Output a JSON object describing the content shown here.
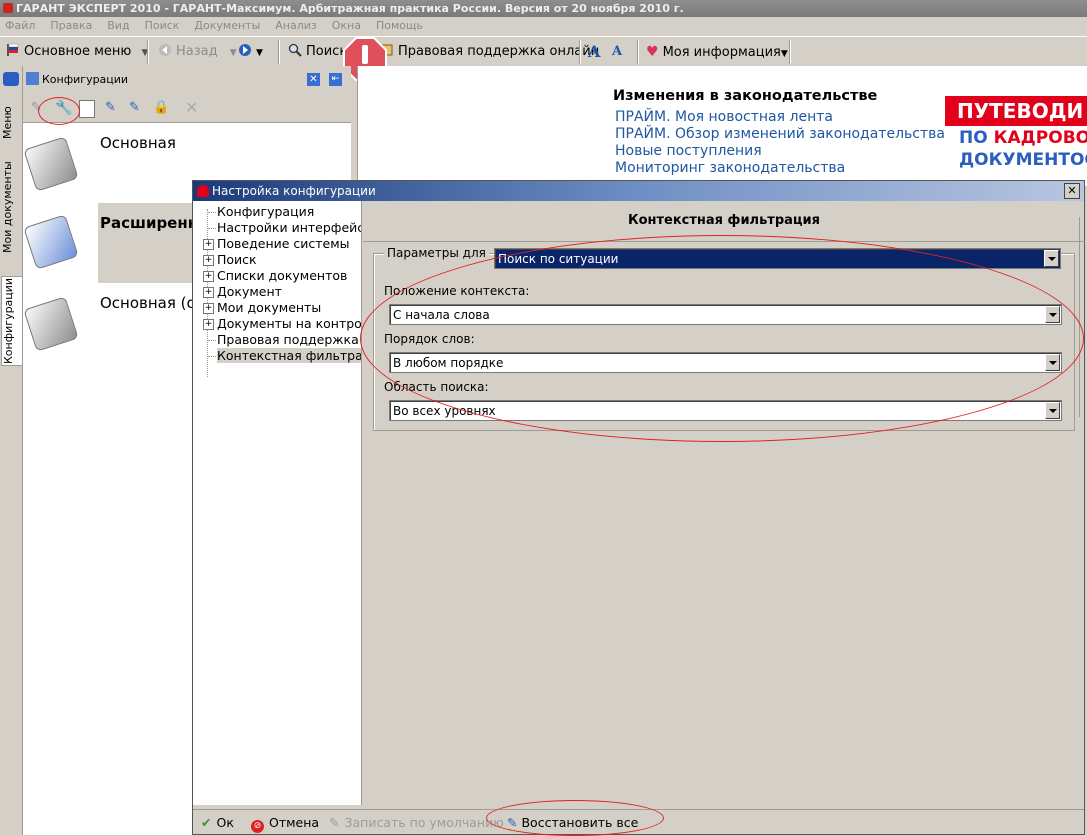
{
  "window": {
    "title": "ГАРАНТ ЭКСПЕРТ 2010 - ГАРАНТ-Максимум. Арбитражная практика России. Версия от 20 ноября 2010 г."
  },
  "menubar": [
    "Файл",
    "Правка",
    "Вид",
    "Поиск",
    "Документы",
    "Анализ",
    "Окна",
    "Помощь"
  ],
  "toolbar": {
    "main_menu": "Основное меню",
    "back": "Назад",
    "search": "Поиск",
    "support": "Правовая поддержка онлайн",
    "my_info": "Моя информация"
  },
  "vtabs": {
    "menu": "Меню",
    "my_docs": "Мои документы",
    "configs": "Конфигурации"
  },
  "config_panel": {
    "title": "Конфигурации",
    "items": [
      "Основная",
      "Расширенн",
      "Основная (с"
    ]
  },
  "content": {
    "heading": "Изменения в законодательстве",
    "links": [
      "ПРАЙМ. Моя новостная лента",
      "ПРАЙМ. Обзор изменений законодательства",
      "Новые поступления",
      "Мониторинг законодательства"
    ],
    "banner_line1": "ПУТЕВОДИ",
    "banner_line2a": "ПО ",
    "banner_line2b": "КАДРОВО",
    "banner_line3": "ДОКУМЕНТОС"
  },
  "dialog": {
    "title": "Настройка конфигурации",
    "tree": [
      {
        "label": "Конфигурация",
        "expandable": false
      },
      {
        "label": "Настройки интерфейса",
        "expandable": false
      },
      {
        "label": "Поведение системы",
        "expandable": true
      },
      {
        "label": "Поиск",
        "expandable": true
      },
      {
        "label": "Списки документов",
        "expandable": true
      },
      {
        "label": "Документ",
        "expandable": true
      },
      {
        "label": "Мои документы",
        "expandable": true
      },
      {
        "label": "Документы на контроле",
        "expandable": true
      },
      {
        "label": "Правовая поддержка он",
        "expandable": false
      },
      {
        "label": "Контекстная фильтрация",
        "expandable": false
      }
    ],
    "panel_title": "Контекстная фильтрация",
    "params_label": "Параметры для",
    "params_value": "Поиск по ситуации",
    "context_pos_label": "Положение контекста:",
    "context_pos_value": "С начала слова",
    "word_order_label": "Порядок слов:",
    "word_order_value": "В любом порядке",
    "search_area_label": "Область поиска:",
    "search_area_value": "Во всех уровнях",
    "buttons": {
      "ok": "Ок",
      "cancel": "Отмена",
      "save_default": "Записать по умолчанию",
      "restore_all": "Восстановить все"
    }
  },
  "colors": {
    "link": "#1f57a2",
    "banner_red": "#e3001b",
    "selection": "#0a246a",
    "annotation": "#e02020"
  }
}
